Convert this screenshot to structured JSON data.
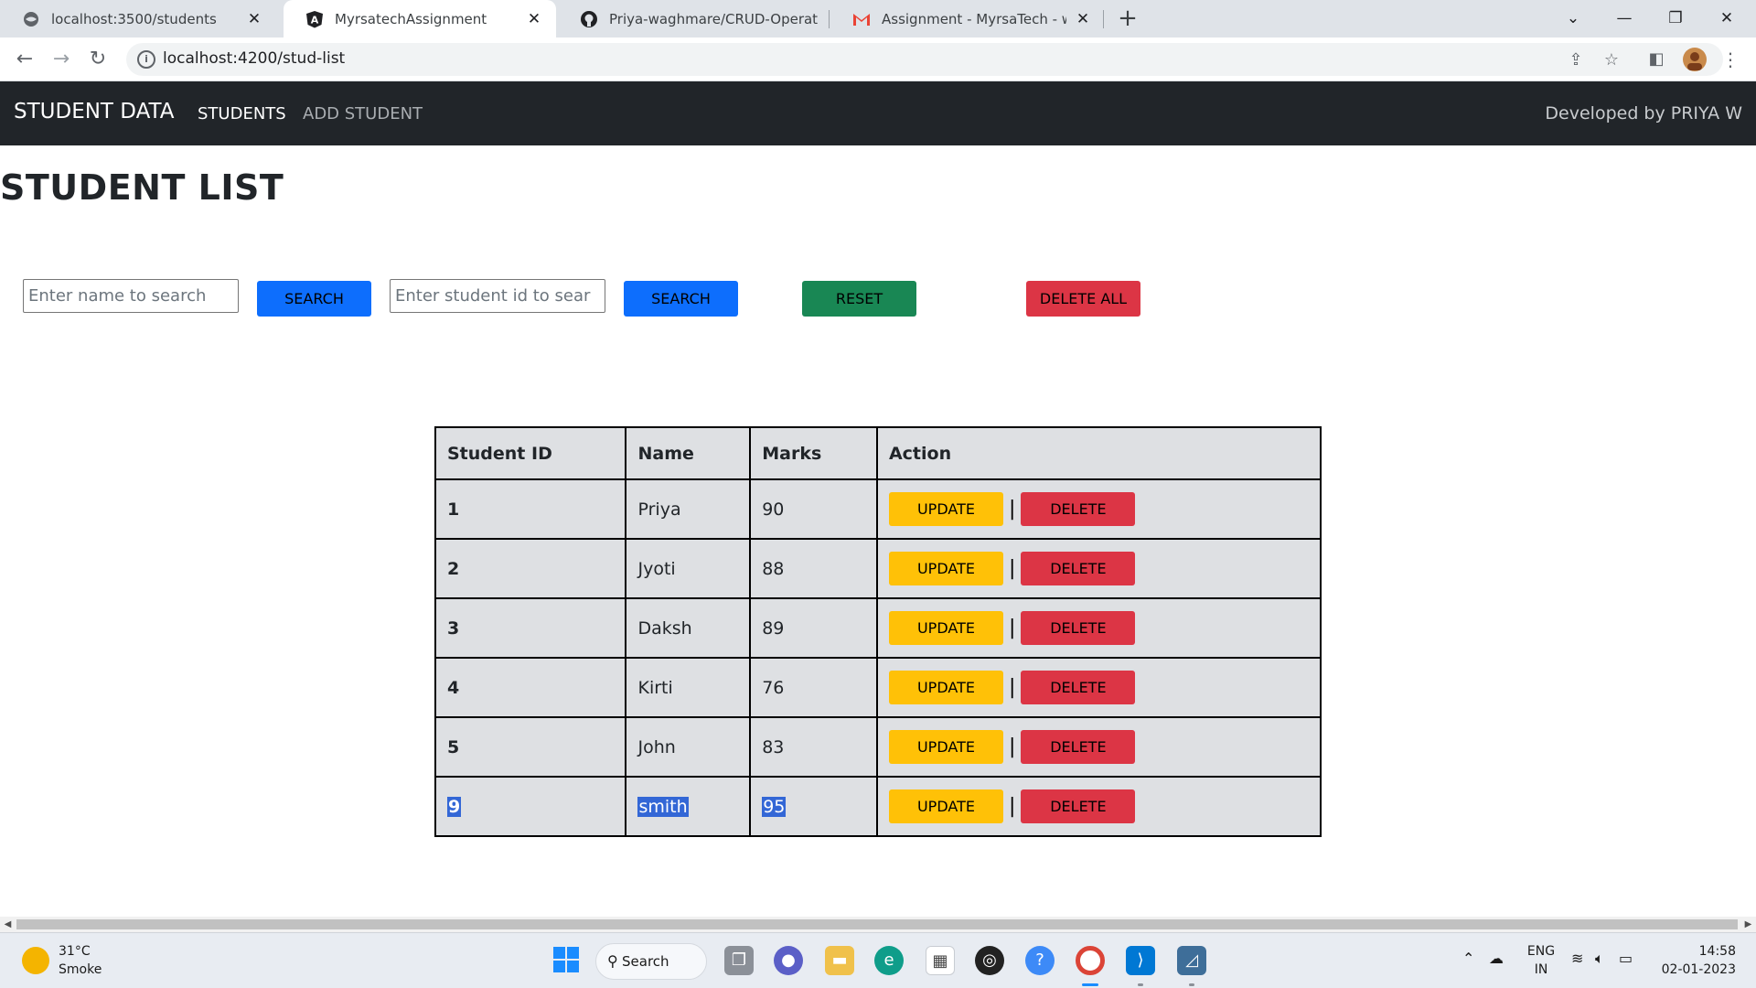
{
  "browser": {
    "tabs": [
      {
        "title": "localhost:3500/students",
        "active": false
      },
      {
        "title": "MyrsatechAssignment",
        "active": true
      },
      {
        "title": "Priya-waghmare/CRUD-Operatio",
        "active": false
      },
      {
        "title": "Assignment - MyrsaTech - wpriya",
        "active": false
      }
    ],
    "new_tab": "+",
    "url": "localhost:4200/stud-list"
  },
  "navbar": {
    "brand": "STUDENT DATA",
    "links": [
      "STUDENTS",
      "ADD STUDENT"
    ],
    "developer": "Developed by PRIYA W"
  },
  "page": {
    "title": "STUDENT LIST",
    "name_search_placeholder": "Enter name to search",
    "id_search_placeholder": "Enter student id to sear",
    "search_label": "SEARCH",
    "reset_label": "RESET",
    "delete_all_label": "DELETE ALL"
  },
  "table": {
    "headers": [
      "Student ID",
      "Name",
      "Marks",
      "Action"
    ],
    "update_label": "UPDATE",
    "delete_label": "DELETE",
    "separator": "|",
    "rows": [
      {
        "id": "1",
        "name": "Priya",
        "marks": "90"
      },
      {
        "id": "2",
        "name": "Jyoti",
        "marks": "88"
      },
      {
        "id": "3",
        "name": "Daksh",
        "marks": "89"
      },
      {
        "id": "4",
        "name": "Kirti",
        "marks": "76"
      },
      {
        "id": "5",
        "name": "John",
        "marks": "83"
      },
      {
        "id": "9",
        "name": "smith",
        "marks": "95"
      }
    ],
    "selected_row_index": 5
  },
  "taskbar": {
    "weather_temp": "31°C",
    "weather_desc": "Smoke",
    "search_label": "Search",
    "lang_top": "ENG",
    "lang_bottom": "IN",
    "time": "14:58",
    "date": "02-01-2023"
  },
  "colors": {
    "primary": "#0d6efd",
    "success": "#198754",
    "danger": "#dc3545",
    "warning": "#ffc107",
    "navbar": "#212529",
    "selection": "#3367d6"
  }
}
